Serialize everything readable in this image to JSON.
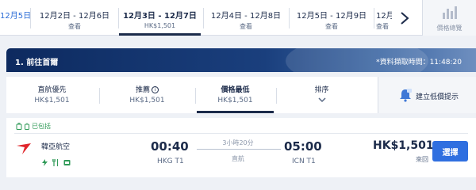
{
  "date_tabs": [
    {
      "dates": "12月5日",
      "price": ""
    },
    {
      "dates": "12月2日 - 12月6日",
      "price": "查看"
    },
    {
      "dates": "12月3日 - 12月7日",
      "price": "HK$1,501"
    },
    {
      "dates": "12月4日 - 12月8日",
      "price": "查看"
    },
    {
      "dates": "12月5日 - 12月9日",
      "price": "查看"
    },
    {
      "dates": "12月5",
      "price": "查看"
    }
  ],
  "price_graph_label": "價格總覽",
  "leg": {
    "title": "1. 前往首爾",
    "fetch_time": "*資料擷取時間：11:48:20"
  },
  "sort_options": [
    {
      "name": "直航優先",
      "value": "HK$1,501"
    },
    {
      "name": "推薦",
      "value": "HK$1,501"
    },
    {
      "name": "價格最低",
      "value": "HK$1,501"
    },
    {
      "name": "排序",
      "value": ""
    }
  ],
  "price_alert_label": "建立低價提示",
  "flight": {
    "included": "已包括",
    "airline": "韓亞航空",
    "depart_time": "00:40",
    "depart_airport": "HKG T1",
    "duration": "3小時20分",
    "stops": "直航",
    "arrive_time": "05:00",
    "arrive_airport": "ICN T1",
    "price": "HK$1,501",
    "price_note": "來回",
    "select_label": "選擇"
  },
  "colors": {
    "accent": "#2f6fe0",
    "navy": "#0d2a5f",
    "included_green": "#2f9a57",
    "airline_red": "#e0262c"
  }
}
